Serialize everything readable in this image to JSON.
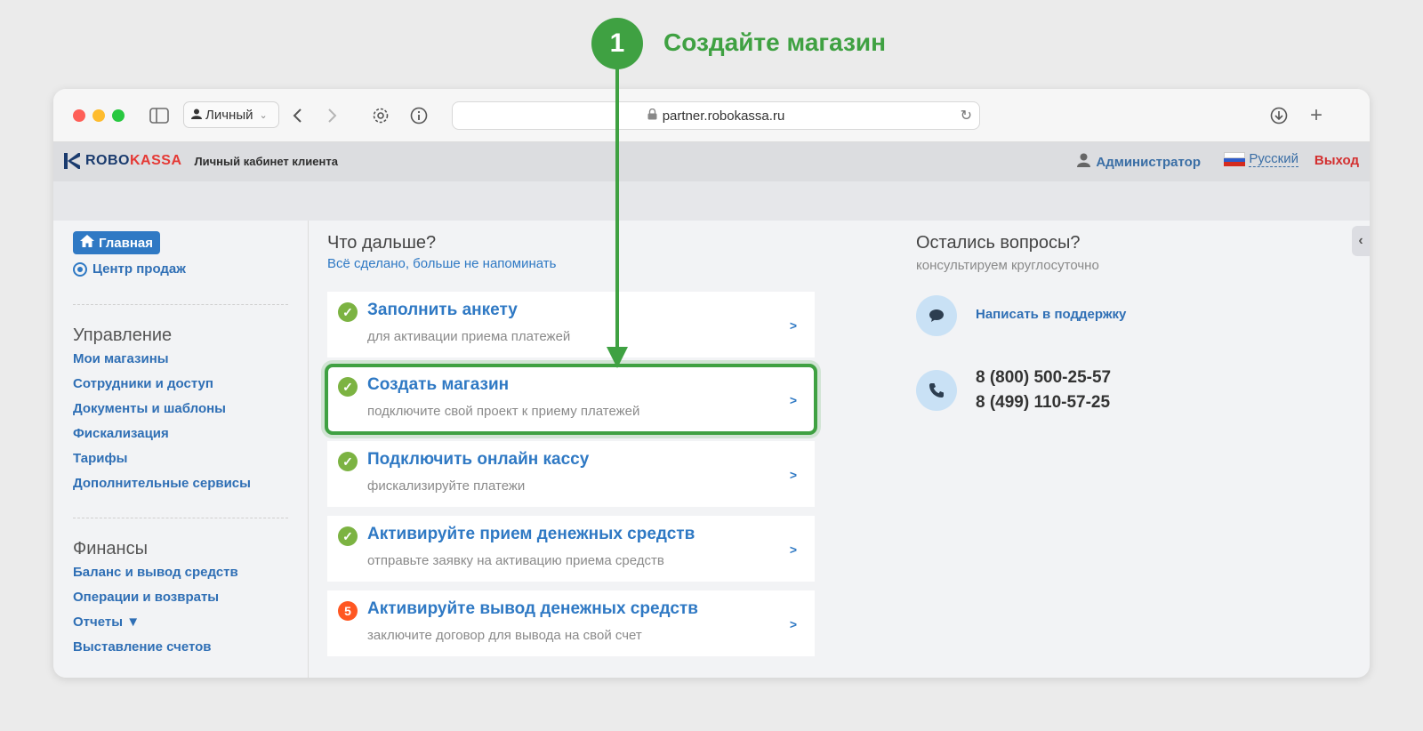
{
  "callout": {
    "number": "1",
    "title": "Создайте магазин",
    "color": "#3fa142"
  },
  "browser": {
    "profile": "Личный",
    "url": "partner.robokassa.ru"
  },
  "header": {
    "logo_robo": "ROBO",
    "logo_kassa": "KASSA",
    "subtitle": "Личный кабинет клиента",
    "admin": "Администратор",
    "language": "Русский",
    "logout": "Выход"
  },
  "sidebar": {
    "home": "Главная",
    "sales_center": "Центр продаж",
    "management_title": "Управление",
    "management": [
      "Мои магазины",
      "Сотрудники и доступ",
      "Документы и шаблоны",
      "Фискализация",
      "Тарифы",
      "Дополнительные сервисы"
    ],
    "finance_title": "Финансы",
    "finance": [
      "Баланс и вывод средств",
      "Операции и возвраты",
      "Отчеты ▼",
      "Выставление счетов"
    ]
  },
  "main": {
    "next_title": "Что дальше?",
    "dismiss": "Всё сделано, больше не напоминать",
    "steps": [
      {
        "title": "Заполнить анкету",
        "desc": "для активации приема платежей",
        "status": "done",
        "icon": "check-icon"
      },
      {
        "title": "Создать магазин",
        "desc": "подключите свой проект к приему платежей",
        "status": "done",
        "icon": "check-icon",
        "highlighted": true
      },
      {
        "title": "Подключить онлайн кассу",
        "desc": "фискализируйте платежи",
        "status": "done",
        "icon": "check-icon"
      },
      {
        "title": "Активируйте прием денежных средств",
        "desc": "отправьте заявку на активацию приема средств",
        "status": "done",
        "icon": "check-icon"
      },
      {
        "title": "Активируйте вывод денежных средств",
        "desc": "заключите договор для вывода на свой счет",
        "status": "pending",
        "badge": "5"
      }
    ],
    "chevron": ">"
  },
  "support": {
    "title": "Остались вопросы?",
    "subtitle": "консультируем круглосуточно",
    "write": "Написать в поддержку",
    "phone1": "8 (800) 500-25-57",
    "phone2": "8 (499) 110-57-25"
  }
}
